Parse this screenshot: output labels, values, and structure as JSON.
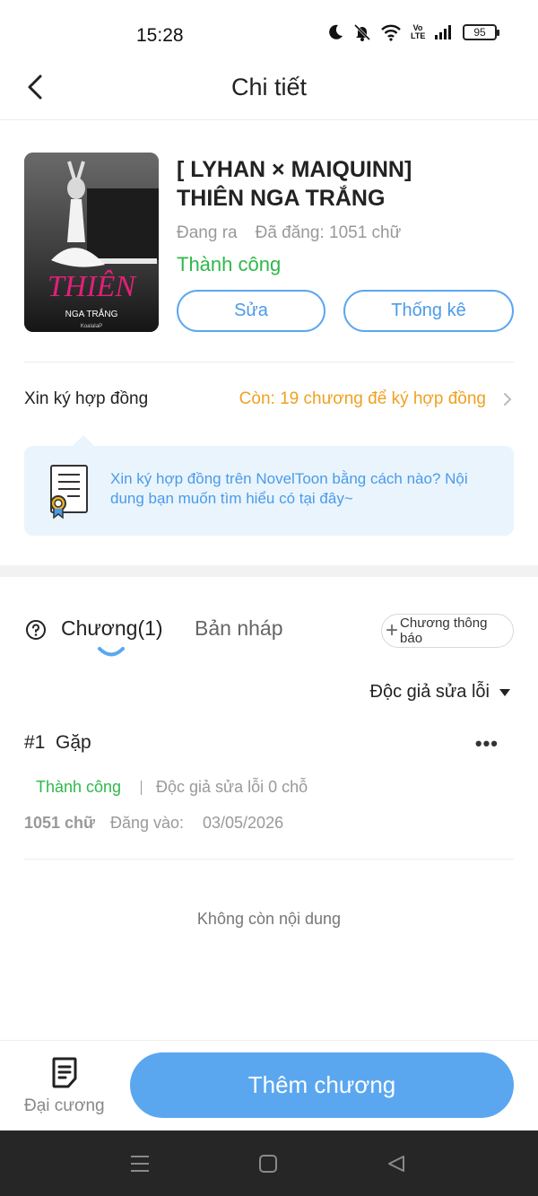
{
  "status_bar": {
    "time": "15:28",
    "network_label": "Vo LTE",
    "battery": "95"
  },
  "header": {
    "title": "Chi tiết"
  },
  "book": {
    "cover_title": "THIÊN",
    "cover_subtitle": "NGA TRẮNG",
    "cover_author": "KoalaIaP",
    "title_line1": "[ LYHAN × MAIQUINN]",
    "title_line2": "THIÊN NGA TRẮNG",
    "state": "Đang ra",
    "words": "Đã đăng: 1051 chữ",
    "status": "Thành công",
    "edit_label": "Sửa",
    "stats_label": "Thống kê"
  },
  "contract": {
    "label": "Xin ký hợp đồng",
    "remaining": "Còn: 19 chương để ký hợp đồng",
    "info_text": "Xin ký hợp đồng trên NovelToon bằng cách nào? Nội dung bạn muốn tìm hiểu có tại đây~"
  },
  "tabs": {
    "chapters": "Chương(1)",
    "drafts": "Bản nháp",
    "notice_button": "Chương thông báo"
  },
  "filter": {
    "reader_fix": "Độc giả sửa lỗi"
  },
  "chapters": [
    {
      "title": "#1  Gặp",
      "status": "Thành công",
      "fix_count": "Độc giả sửa lỗi 0 chỗ",
      "words": "1051 chữ",
      "date_label": "Đăng vào:",
      "date": "03/05/2026",
      "more": "•••"
    }
  ],
  "list_end": "Không còn nội dung",
  "bottom": {
    "outline_label": "Đại cương",
    "add_chapter_label": "Thêm chương"
  },
  "colors": {
    "accent": "#5aa7f0",
    "success": "#2fb84a",
    "warning": "#f0a020",
    "info_bg": "#eaf4fd"
  },
  "icons": {
    "back": "chevron-left-icon",
    "moon": "moon-icon",
    "bell_off": "bell-off-icon",
    "wifi": "wifi-icon",
    "signal": "signal-icon",
    "battery": "battery-icon",
    "contract_chevron": "chevron-right-icon",
    "doc": "certificate-icon",
    "help": "question-circle-icon",
    "plus": "plus-icon",
    "dropdown": "triangle-down-icon",
    "outline": "document-icon",
    "nav_menu": "menu-icon",
    "nav_home": "square-icon",
    "nav_back": "triangle-back-icon"
  }
}
